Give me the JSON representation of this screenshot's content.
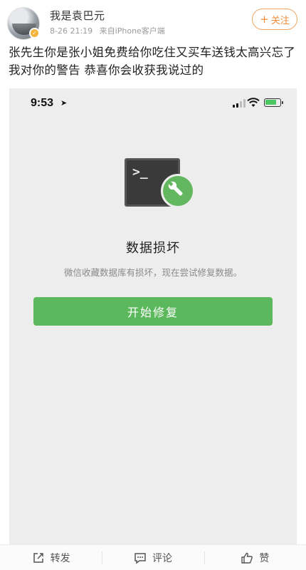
{
  "post": {
    "username": "我是袁巴元",
    "date": "8-26 21:19",
    "source": "来自iPhone客户端",
    "follow_label": "关注",
    "text": "张先生你是张小姐免费给你吃住又买车送钱太高兴忘了我对你的警告 恭喜你会收获我说过的"
  },
  "screenshot": {
    "status_time": "9:53",
    "terminal_prompt": ">_",
    "title": "数据损坏",
    "subtitle": "微信收藏数据库有损坏，现在尝试修复数据。",
    "button_label": "开始修复",
    "battery_level": 0.8,
    "colors": {
      "accent": "#5cb85c",
      "background": "#ededed"
    }
  },
  "toolbar": {
    "items": [
      {
        "label": "转发",
        "icon": "repost-icon"
      },
      {
        "label": "评论",
        "icon": "comment-icon"
      },
      {
        "label": "赞",
        "icon": "like-icon"
      }
    ]
  }
}
